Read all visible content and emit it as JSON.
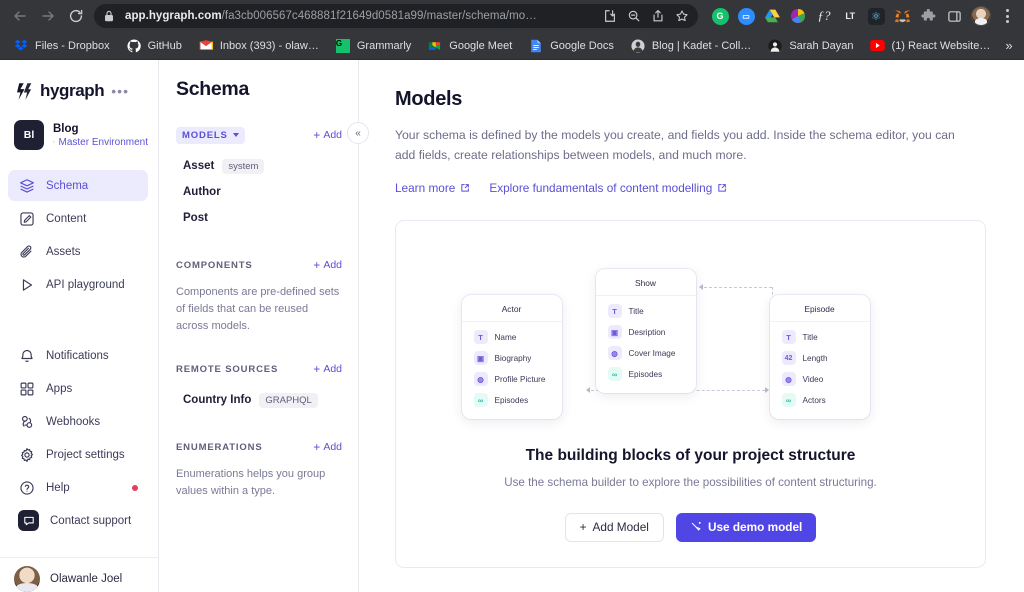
{
  "browser": {
    "nav": {
      "back": "back-arrow",
      "forward": "forward-arrow",
      "reload": "reload"
    },
    "url": {
      "domain": "app.hygraph.com",
      "path": "/fa3cb006567c468881f21649d0581a99/master/schema/mo…",
      "lock": "lock-icon"
    },
    "omnibox_icons": [
      "install-icon",
      "search-icon",
      "share-icon",
      "bookmark-star-icon"
    ],
    "extensions": [
      {
        "name": "Grammarly",
        "glyph": "G",
        "color": "#15c26b"
      },
      {
        "name": "Zoom",
        "glyph": "▢",
        "color": "#2d8cff"
      },
      {
        "name": "Google Drive",
        "glyph": "▲",
        "color": "#1a73e8"
      },
      {
        "name": "Color Picker",
        "glyph": "◕",
        "color": "#e84a3f"
      },
      {
        "name": "Fontanello",
        "glyph": "ƒ?",
        "color": "#e8eaed"
      },
      {
        "name": "LanguageTool",
        "glyph": "LT",
        "color": "#e8eaed"
      },
      {
        "name": "React Developer Tools",
        "glyph": "⚛",
        "color": "#61dafb"
      },
      {
        "name": "MetaMask",
        "glyph": "🦊",
        "color": "#f6851b"
      },
      {
        "name": "Extensions",
        "glyph": "🧩",
        "color": "#9aa0a6"
      },
      {
        "name": "Side panel",
        "glyph": "▯",
        "color": "#c8ccd0"
      }
    ],
    "profile": "profile-avatar",
    "menu": "chrome-menu",
    "bookmarks": [
      {
        "label": "Files - Dropbox",
        "glyph": "▼",
        "color": "#0061ff"
      },
      {
        "label": "GitHub",
        "glyph": "",
        "color": "#ffffff"
      },
      {
        "label": "Inbox (393) - olaw…",
        "glyph": "M",
        "color": "#ea4335"
      },
      {
        "label": "Grammarly",
        "glyph": "G",
        "color": "#15c26b"
      },
      {
        "label": "Google Meet",
        "glyph": "▣",
        "color": "#00832d"
      },
      {
        "label": "Google Docs",
        "glyph": "▤",
        "color": "#4285f4"
      },
      {
        "label": "Blog | Kadet - Coll…",
        "glyph": "◉",
        "color": "#bdbdbd"
      },
      {
        "label": "Sarah Dayan",
        "glyph": "◉",
        "color": "#6e6e6e"
      },
      {
        "label": "(1) React Website…",
        "glyph": "▶",
        "color": "#ff0000"
      }
    ],
    "bookmarks_overflow": "»"
  },
  "sidebar": {
    "brand": {
      "name": "hygraph",
      "more": "•••"
    },
    "project": {
      "initials": "Bl",
      "name": "Blog",
      "environment": "Master Environment"
    },
    "items": [
      {
        "label": "Schema",
        "icon": "layers-icon",
        "active": true
      },
      {
        "label": "Content",
        "icon": "edit-square-icon",
        "active": false
      },
      {
        "label": "Assets",
        "icon": "paperclip-icon",
        "active": false
      },
      {
        "label": "API playground",
        "icon": "play-icon",
        "active": false
      }
    ],
    "items2": [
      {
        "label": "Notifications",
        "icon": "bell-icon",
        "dot": false
      },
      {
        "label": "Apps",
        "icon": "grid-icon",
        "dot": false
      },
      {
        "label": "Webhooks",
        "icon": "webhook-icon",
        "dot": false
      },
      {
        "label": "Project settings",
        "icon": "gear-icon",
        "dot": false
      },
      {
        "label": "Help",
        "icon": "question-circle-icon",
        "dot": true
      },
      {
        "label": "Contact support",
        "icon": "chat-icon",
        "dot": false
      }
    ],
    "user": {
      "name": "Olawanle Joel",
      "avatar": "user-avatar"
    }
  },
  "schema_panel": {
    "title": "Schema",
    "collapse": "«",
    "sections": [
      {
        "label": "MODELS",
        "chip": true,
        "caret": true,
        "add": "Add",
        "items": [
          {
            "name": "Asset",
            "tag": "system"
          },
          {
            "name": "Author",
            "tag": ""
          },
          {
            "name": "Post",
            "tag": ""
          }
        ],
        "description": ""
      },
      {
        "label": "COMPONENTS",
        "chip": false,
        "caret": false,
        "add": "Add",
        "items": [],
        "description": "Components are pre-defined sets of fields that can be reused across models."
      },
      {
        "label": "REMOTE SOURCES",
        "chip": false,
        "caret": false,
        "add": "Add",
        "items": [
          {
            "name": "Country Info",
            "tag": "GRAPHQL"
          }
        ],
        "description": ""
      },
      {
        "label": "ENUMERATIONS",
        "chip": false,
        "caret": false,
        "add": "Add",
        "items": [],
        "description": "Enumerations helps you group values within a type."
      }
    ]
  },
  "main": {
    "title": "Models",
    "description": "Your schema is defined by the models you create, and fields you add. Inside the schema editor, you can add fields, create relationships between models, and much more.",
    "links": [
      {
        "label": "Learn more",
        "icon": "external-link-icon"
      },
      {
        "label": "Explore fundamentals of content modelling",
        "icon": "external-link-icon"
      }
    ],
    "empty_state": {
      "heading": "The building blocks of your project structure",
      "subheading": "Use the schema builder to explore the possibilities of content structuring.",
      "buttons": [
        {
          "label": "Add Model",
          "icon": "plus-icon",
          "variant": "secondary"
        },
        {
          "label": "Use demo model",
          "icon": "wand-icon",
          "variant": "primary"
        }
      ]
    },
    "diagram": {
      "nodes": [
        {
          "title": "Actor",
          "fields": [
            {
              "label": "Name",
              "icon": "T",
              "type": "text"
            },
            {
              "label": "Biography",
              "icon": "▣",
              "type": "richtext"
            },
            {
              "label": "Profile Picture",
              "icon": "◍",
              "type": "asset"
            },
            {
              "label": "Episodes",
              "icon": "∞",
              "type": "reference"
            }
          ]
        },
        {
          "title": "Show",
          "fields": [
            {
              "label": "Title",
              "icon": "T",
              "type": "text"
            },
            {
              "label": "Desription",
              "icon": "▣",
              "type": "richtext"
            },
            {
              "label": "Cover Image",
              "icon": "◍",
              "type": "asset"
            },
            {
              "label": "Episodes",
              "icon": "∞",
              "type": "reference"
            }
          ]
        },
        {
          "title": "Episode",
          "fields": [
            {
              "label": "Title",
              "icon": "T",
              "type": "text"
            },
            {
              "label": "Length",
              "icon": "42",
              "type": "number"
            },
            {
              "label": "Video",
              "icon": "◍",
              "type": "asset"
            },
            {
              "label": "Actors",
              "icon": "∞",
              "type": "reference"
            }
          ]
        }
      ]
    }
  },
  "colors": {
    "accent": "#5b4fd4",
    "primary_button": "#4f46e5",
    "active_nav_bg": "#eceafd",
    "chrome_bg": "#35363a",
    "omnibox_bg": "#202124",
    "notification_dot": "#e3405f"
  }
}
